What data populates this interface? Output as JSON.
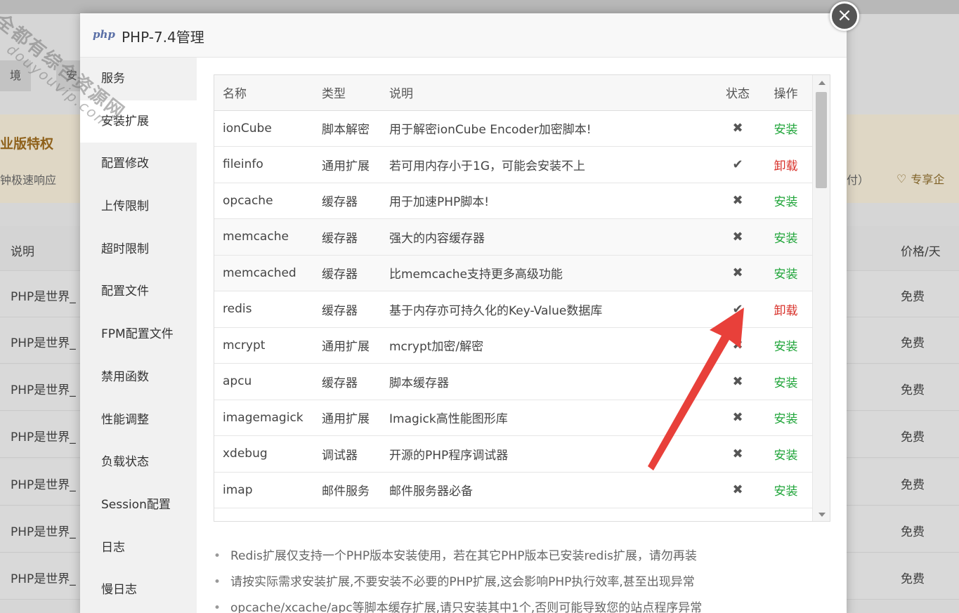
{
  "background": {
    "tabs": [
      "境",
      "安"
    ],
    "banner_title": "业版特权",
    "banner_sub": "钟极速响应",
    "banner_right": "付）",
    "banner_right2": "专享企",
    "table_head_left": "说明",
    "table_head_right": "价格/天",
    "rows": [
      {
        "left": "PHP是世界_",
        "right": "免费"
      },
      {
        "left": "PHP是世界_",
        "right": "免费"
      },
      {
        "left": "PHP是世界_",
        "right": "免费"
      },
      {
        "left": "PHP是世界_",
        "right": "免费"
      },
      {
        "left": "PHP是世界_",
        "right": "免费"
      },
      {
        "left": "PHP是世界_",
        "right": "免费"
      },
      {
        "left": "PHP是世界_",
        "right": "免费"
      }
    ]
  },
  "modal": {
    "logo": "php",
    "title": "PHP-7.4管理",
    "close_icon": "×",
    "sidebar": [
      {
        "label": "服务",
        "active": false
      },
      {
        "label": "安装扩展",
        "active": true
      },
      {
        "label": "配置修改",
        "active": false
      },
      {
        "label": "上传限制",
        "active": false
      },
      {
        "label": "超时限制",
        "active": false
      },
      {
        "label": "配置文件",
        "active": false
      },
      {
        "label": "FPM配置文件",
        "active": false
      },
      {
        "label": "禁用函数",
        "active": false
      },
      {
        "label": "性能调整",
        "active": false
      },
      {
        "label": "负载状态",
        "active": false
      },
      {
        "label": "Session配置",
        "active": false
      },
      {
        "label": "日志",
        "active": false
      },
      {
        "label": "慢日志",
        "active": false
      }
    ],
    "table": {
      "headers": {
        "name": "名称",
        "type": "类型",
        "desc": "说明",
        "status": "状态",
        "op": "操作"
      },
      "rows": [
        {
          "name": "ionCube",
          "type": "脚本解密",
          "desc": "用于解密ionCube Encoder加密脚本!",
          "status": "✖",
          "op": "安装"
        },
        {
          "name": "fileinfo",
          "type": "通用扩展",
          "desc": "若可用内存小于1G，可能会安装不上",
          "status": "✔",
          "op": "卸载"
        },
        {
          "name": "opcache",
          "type": "缓存器",
          "desc": "用于加速PHP脚本!",
          "status": "✖",
          "op": "安装"
        },
        {
          "name": "memcache",
          "type": "缓存器",
          "desc": "强大的内容缓存器",
          "status": "✖",
          "op": "安装"
        },
        {
          "name": "memcached",
          "type": "缓存器",
          "desc": "比memcache支持更多高级功能",
          "status": "✖",
          "op": "安装"
        },
        {
          "name": "redis",
          "type": "缓存器",
          "desc": "基于内存亦可持久化的Key-Value数据库",
          "status": "✔",
          "op": "卸载"
        },
        {
          "name": "mcrypt",
          "type": "通用扩展",
          "desc": "mcrypt加密/解密",
          "status": "✖",
          "op": "安装"
        },
        {
          "name": "apcu",
          "type": "缓存器",
          "desc": "脚本缓存器",
          "status": "✖",
          "op": "安装"
        },
        {
          "name": "imagemagick",
          "type": "通用扩展",
          "desc": "Imagick高性能图形库",
          "status": "✖",
          "op": "安装"
        },
        {
          "name": "xdebug",
          "type": "调试器",
          "desc": "开源的PHP程序调试器",
          "status": "✖",
          "op": "安装"
        },
        {
          "name": "imap",
          "type": "邮件服务",
          "desc": "邮件服务器必备",
          "status": "✖",
          "op": "安装"
        }
      ]
    },
    "notes": [
      "Redis扩展仅支持一个PHP版本安装使用，若在其它PHP版本已安装redis扩展，请勿再装",
      "请按实际需求安装扩展,不要安装不必要的PHP扩展,这会影响PHP执行效率,甚至出现异常",
      "opcache/xcache/apc等脚本缓存扩展,请只安装其中1个,否则可能导致您的站点程序异常"
    ]
  },
  "watermark": {
    "line1": "全都有综合资源网",
    "line2": "douyouvip.com"
  },
  "colors": {
    "install": "#20a53a",
    "uninstall": "#d8312a",
    "arrow": "#e8403a"
  },
  "icons": {
    "installed": "check-icon",
    "not_installed": "cross-icon",
    "close": "close-icon"
  }
}
